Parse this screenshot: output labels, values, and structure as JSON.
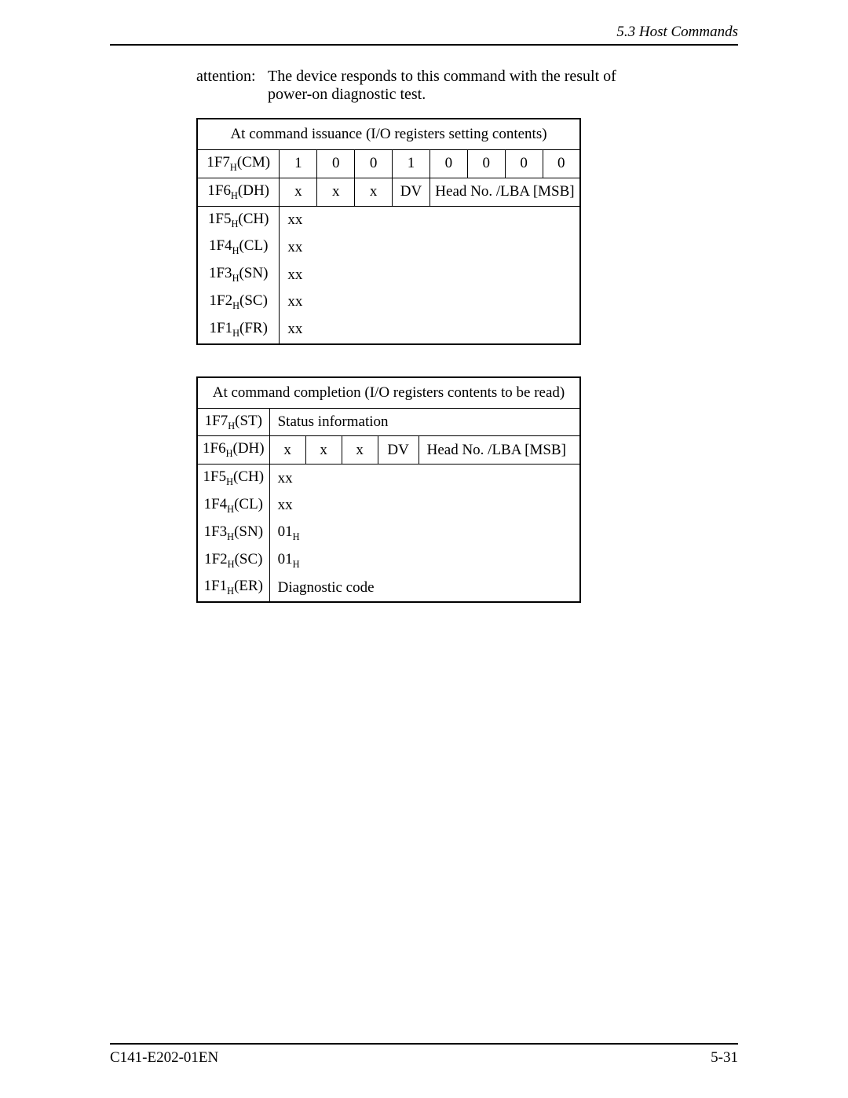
{
  "header": {
    "section": "5.3  Host Commands"
  },
  "attention": {
    "label": "attention:",
    "text": "The device responds to this command with the result of power-on diagnostic test."
  },
  "table1": {
    "title": "At command issuance (I/O registers setting contents)",
    "rows": {
      "cm": {
        "reg": "1F7",
        "suffix": "(CM)",
        "bits": [
          "1",
          "0",
          "0",
          "1",
          "0",
          "0",
          "0",
          "0"
        ]
      },
      "dh": {
        "reg": "1F6",
        "suffix": "(DH)",
        "b1": "x",
        "b2": "x",
        "b3": "x",
        "b4": "DV",
        "head": "Head No. /LBA [MSB]"
      },
      "ch": {
        "reg": "1F5",
        "suffix": "(CH)",
        "val": "xx"
      },
      "cl": {
        "reg": "1F4",
        "suffix": "(CL)",
        "val": "xx"
      },
      "sn": {
        "reg": "1F3",
        "suffix": "(SN)",
        "val": "xx"
      },
      "sc": {
        "reg": "1F2",
        "suffix": "(SC)",
        "val": "xx"
      },
      "fr": {
        "reg": "1F1",
        "suffix": "(FR)",
        "val": "xx"
      }
    }
  },
  "table2": {
    "title": "At command completion (I/O registers contents to be read)",
    "rows": {
      "st": {
        "reg": "1F7",
        "suffix": "(ST)",
        "val": "Status information"
      },
      "dh": {
        "reg": "1F6",
        "suffix": "(DH)",
        "b1": "x",
        "b2": "x",
        "b3": "x",
        "b4": "DV",
        "head": "Head No. /LBA [MSB]"
      },
      "ch": {
        "reg": "1F5",
        "suffix": "(CH)",
        "val": "xx"
      },
      "cl": {
        "reg": "1F4",
        "suffix": "(CL)",
        "val": "xx"
      },
      "sn": {
        "reg": "1F3",
        "suffix": "(SN)",
        "val": "01",
        "sub": "H"
      },
      "sc": {
        "reg": "1F2",
        "suffix": "(SC)",
        "val": "01",
        "sub": "H"
      },
      "er": {
        "reg": "1F1",
        "suffix": "(ER)",
        "val": "Diagnostic code"
      }
    }
  },
  "footer": {
    "left": "C141-E202-01EN",
    "right": "5-31"
  },
  "hsub": "H"
}
